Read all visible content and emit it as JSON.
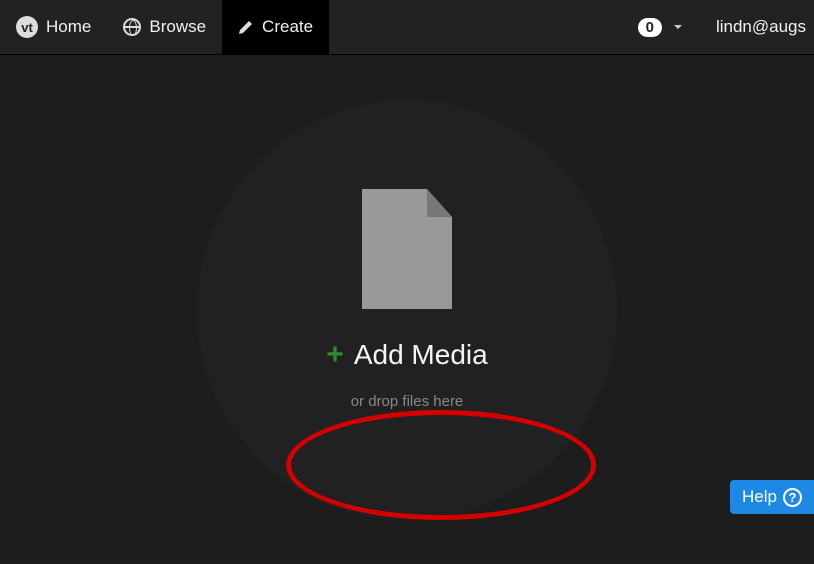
{
  "nav": {
    "logo": "vt",
    "home": "Home",
    "browse": "Browse",
    "create": "Create",
    "count": "0",
    "user": "lindn@augs"
  },
  "media": {
    "add_label": "Add Media",
    "drop_label": "or drop files here"
  },
  "help": {
    "label": "Help"
  }
}
